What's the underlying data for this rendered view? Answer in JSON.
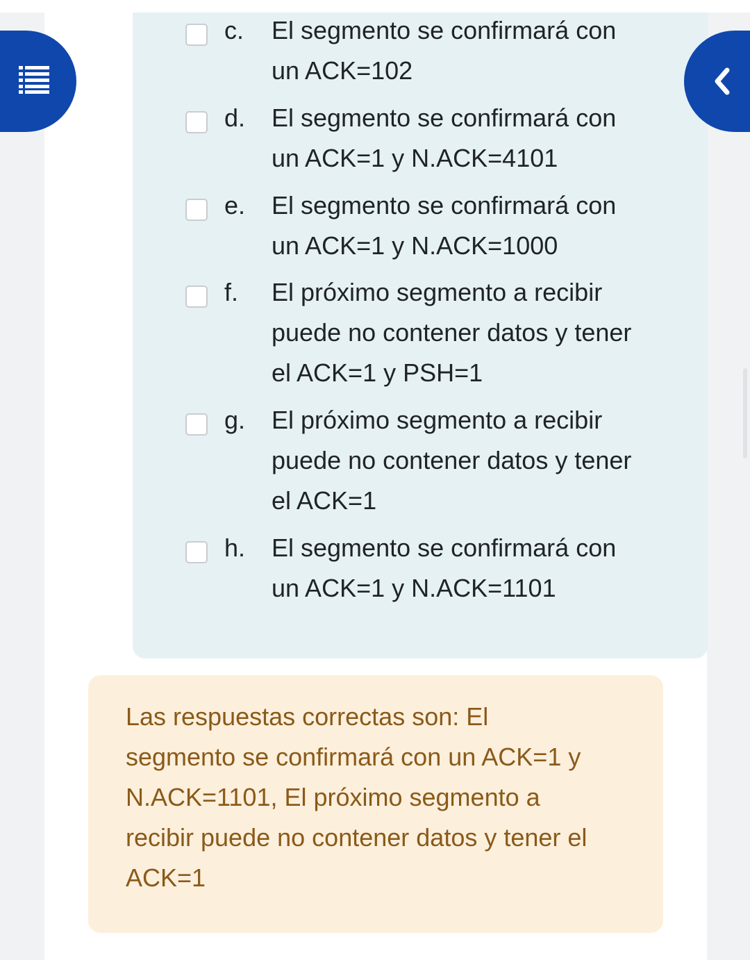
{
  "options": [
    {
      "letter": "c.",
      "lines": [
        "El segmento se confirmará con",
        "un ACK=102"
      ]
    },
    {
      "letter": "d.",
      "lines": [
        "El segmento se confirmará con",
        "un ACK=1 y N.ACK=4101"
      ]
    },
    {
      "letter": "e.",
      "lines": [
        "El segmento se confirmará con",
        "un ACK=1 y N.ACK=1000"
      ]
    },
    {
      "letter": "f.",
      "lines": [
        "El próximo segmento a recibir",
        "puede no contener datos y tener",
        "el ACK=1 y PSH=1"
      ]
    },
    {
      "letter": "g.",
      "lines": [
        "El próximo segmento a recibir",
        "puede no contener datos y tener",
        "el ACK=1"
      ]
    },
    {
      "letter": "h.",
      "lines": [
        "El segmento se confirmará con",
        "un ACK=1 y N.ACK=1101"
      ]
    }
  ],
  "feedback": {
    "lines": [
      "Las respuestas correctas son: El",
      "segmento se confirmará con un ACK=1 y",
      "N.ACK=1101, El próximo segmento a",
      "recibir puede no contener datos y tener el",
      "ACK=1"
    ]
  },
  "nav": {
    "left_icon": "list-icon",
    "right_icon": "chevron-left-icon",
    "color": "#0f47ad"
  },
  "colors": {
    "answer_panel_bg": "#e6f1f4",
    "feedback_bg": "#fcefdc",
    "feedback_text": "#8a5a19"
  }
}
